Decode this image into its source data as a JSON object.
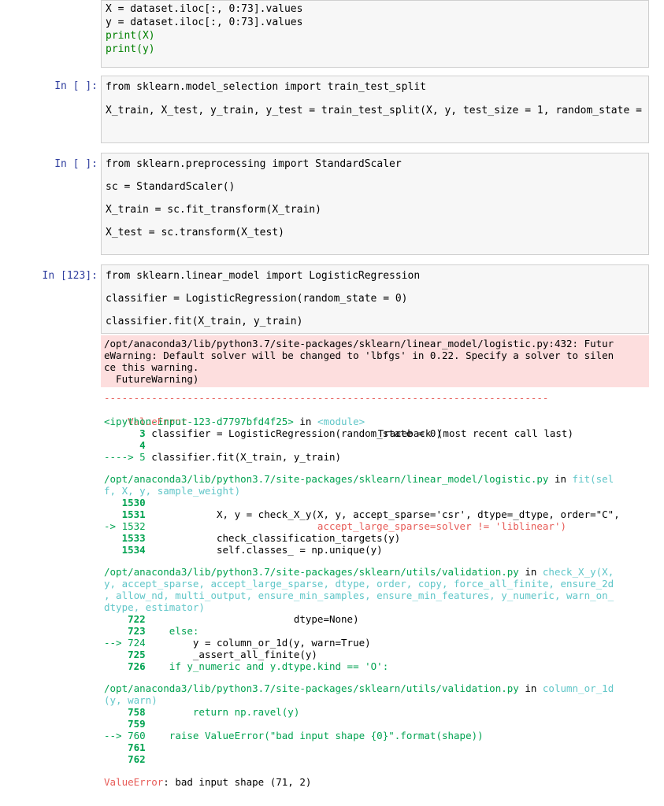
{
  "cell0": {
    "lines": [
      "X = dataset.iloc[:, 0:73].values",
      "y = dataset.iloc[:, 0:73].values",
      "print(X)",
      "print(y)"
    ]
  },
  "cell1": {
    "prompt": "In [ ]:",
    "line1": "from sklearn.model_selection import train_test_split",
    "line2": "X_train, X_test, y_train, y_test = train_test_split(X, y, test_size = 1, random_state ="
  },
  "cell2": {
    "prompt": "In [ ]:",
    "line1": "from sklearn.preprocessing import StandardScaler",
    "line2": "sc = StandardScaler()",
    "line3": "X_train = sc.fit_transform(X_train)",
    "line4": "X_test = sc.transform(X_test)"
  },
  "cell3": {
    "prompt": "In [123]:",
    "line1": "from sklearn.linear_model import LogisticRegression",
    "line2": "classifier = LogisticRegression(random_state = 0)",
    "line3": "classifier.fit(X_train, y_train)",
    "warning": [
      "/opt/anaconda3/lib/python3.7/site-packages/sklearn/linear_model/logistic.py:432: Futur",
      "eWarning: Default solver will be changed to 'lbfgs' in 0.22. Specify a solver to silen",
      "ce this warning.",
      "  FutureWarning)"
    ],
    "traceback": {
      "dashes": "---------------------------------------------------------------------------",
      "error_name": "ValueError",
      "traceback_header": "Traceback (most recent call last)",
      "input_ref": "<ipython-input-123-d7797bfd4f25>",
      "in_word": " in ",
      "module": "<module>",
      "f1": [
        {
          "num": "      3",
          "code": " classifier = LogisticRegression(random_state = 0)"
        },
        {
          "num": "      4",
          "code": ""
        },
        {
          "num": "----> 5",
          "code": " classifier.fit(X_train, y_train)"
        }
      ],
      "frame2_path": "/opt/anaconda3/lib/python3.7/site-packages/sklearn/linear_model/logistic.py",
      "frame2_in": " in ",
      "frame2_func": "fit(sel",
      "frame2_cont": "f, X, y, sample_weight)",
      "f2": [
        {
          "num": "   1530",
          "code": ""
        },
        {
          "num": "   1531",
          "code": "            X, y = check_X_y(X, y, accept_sparse='csr', dtype=_dtype, order=\"C\","
        },
        {
          "num": "-> 1532",
          "code": "                             accept_large_sparse=solver != 'liblinear')"
        },
        {
          "num": "   1533",
          "code": "            check_classification_targets(y)"
        },
        {
          "num": "   1534",
          "code": "            self.classes_ = np.unique(y)"
        }
      ],
      "frame3_path": "/opt/anaconda3/lib/python3.7/site-packages/sklearn/utils/validation.py",
      "frame3_in": " in ",
      "frame3_func": "check_X_y(X,",
      "frame3_cont": [
        "y, accept_sparse, accept_large_sparse, dtype, order, copy, force_all_finite, ensure_2d",
        ", allow_nd, multi_output, ensure_min_samples, ensure_min_features, y_numeric, warn_on_",
        "dtype, estimator)"
      ],
      "f3": [
        {
          "num": "    722",
          "code": "                         dtype=None)"
        },
        {
          "num": "    723",
          "code": "    else:"
        },
        {
          "num": "--> 724",
          "code": "        y = column_or_1d(y, warn=True)"
        },
        {
          "num": "    725",
          "code": "        _assert_all_finite(y)"
        },
        {
          "num": "    726",
          "code": "    if y_numeric and y.dtype.kind == 'O':"
        }
      ],
      "frame4_path": "/opt/anaconda3/lib/python3.7/site-packages/sklearn/utils/validation.py",
      "frame4_in": " in ",
      "frame4_func": "column_or_1d",
      "frame4_cont": "(y, warn)",
      "f4": [
        {
          "num": "    758",
          "code": "        return np.ravel(y)"
        },
        {
          "num": "    759",
          "code": ""
        },
        {
          "num": "--> 760",
          "code": "    raise ValueError(\"bad input shape {0}\".format(shape))"
        },
        {
          "num": "    761",
          "code": ""
        },
        {
          "num": "    762",
          "code": ""
        }
      ],
      "final_name": "ValueError",
      "final_msg": ": bad input shape (71, 2)"
    }
  }
}
